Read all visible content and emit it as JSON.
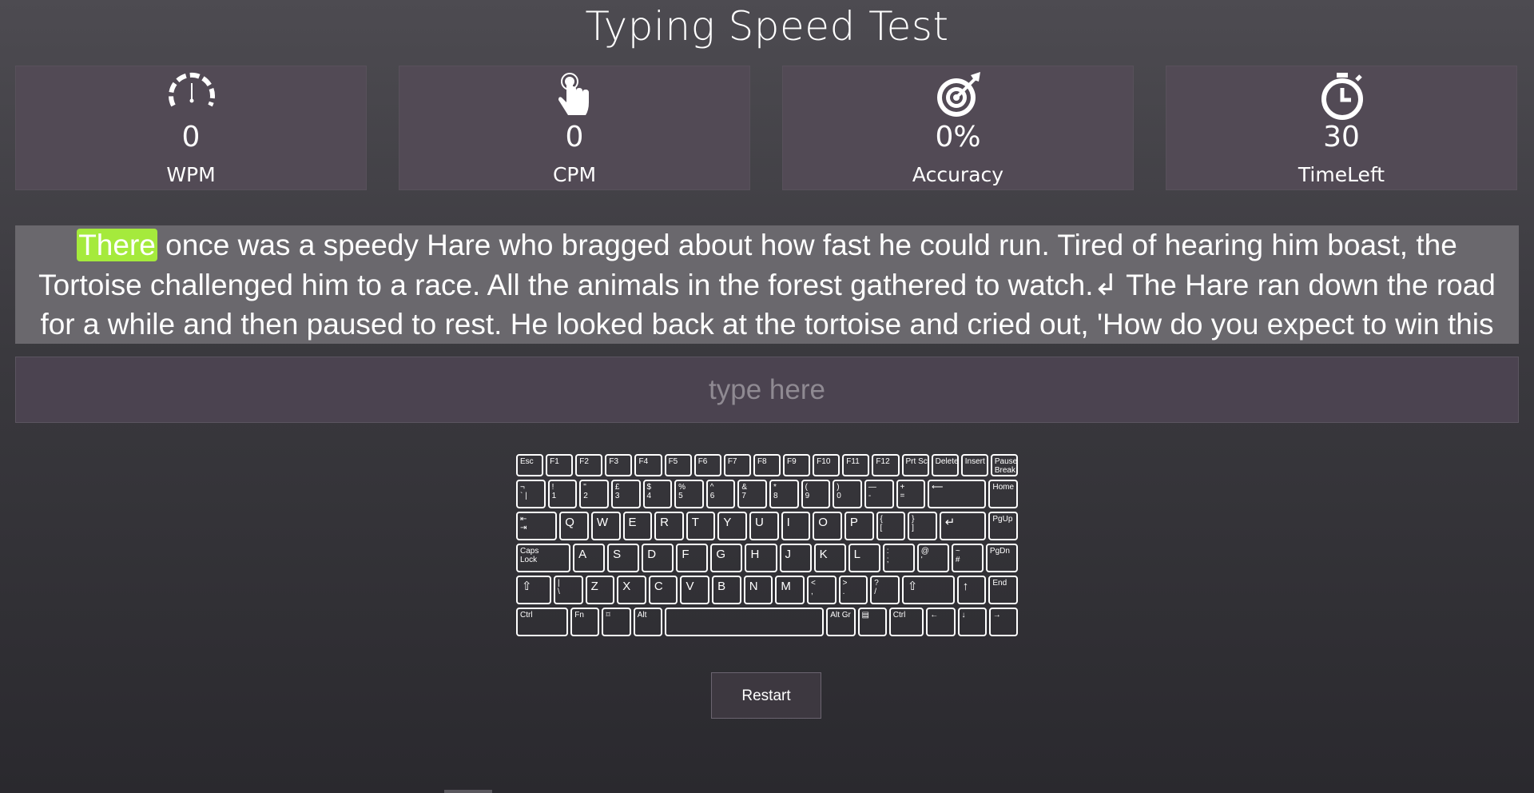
{
  "title": "Typing Speed Test",
  "stats": [
    {
      "icon": "speedometer-icon",
      "value": "0",
      "label": "WPM"
    },
    {
      "icon": "tap-hand-icon",
      "value": "0",
      "label": "CPM"
    },
    {
      "icon": "target-icon",
      "value": "0%",
      "label": "Accuracy"
    },
    {
      "icon": "stopwatch-icon",
      "value": "30",
      "label": "TimeLeft"
    }
  ],
  "passage": {
    "current_word": "There",
    "line1_rest": " once was a speedy Hare who bragged about how fast he could run. Tired of hearing him boast, the",
    "line2": "Tortoise challenged him to a race. All the animals in the forest gathered to watch.↲ The Hare ran down the road",
    "line3": "for a while and then paused to rest. He looked back at the tortoise and cried out, 'How do you expect to win this"
  },
  "input": {
    "placeholder": "type here",
    "value": ""
  },
  "restart_label": "Restart",
  "colors": {
    "highlight": "#a5ea3c",
    "panel": "#524a55",
    "passage_bg": "#6a686d"
  },
  "keyboard": {
    "row0": [
      "Esc",
      "F1",
      "F2",
      "F3",
      "F4",
      "F5",
      "F6",
      "F7",
      "F8",
      "F9",
      "F10",
      "F11",
      "F12",
      "Prt Sc",
      "Delete",
      "Insert",
      "Pause\nBreak"
    ],
    "row1": [
      "¬\n` |",
      "!\n1",
      "\"\n2",
      "£\n3",
      "$\n4",
      "%\n5",
      "^\n6",
      "&\n7",
      "*\n8",
      "(\n9",
      ")\n0",
      "—\n-",
      "+\n=",
      "⟵",
      "Home"
    ],
    "row2": [
      "⇤\n⇥",
      "Q",
      "W",
      "E",
      "R",
      "T",
      "Y",
      "U",
      "I",
      "O",
      "P",
      "{\n[",
      "}\n]",
      "↵",
      "PgUp"
    ],
    "row3": [
      "Caps\nLock",
      "A",
      "S",
      "D",
      "F",
      "G",
      "H",
      "J",
      "K",
      "L",
      ":\n;",
      "@\n'",
      "~\n#",
      "PgDn"
    ],
    "row4": [
      "⇧",
      "|\n\\",
      "Z",
      "X",
      "C",
      "V",
      "B",
      "N",
      "M",
      "<\n,",
      ">\n.",
      "?\n/",
      "⇧",
      "↑",
      "End"
    ],
    "row5": [
      "Ctrl",
      "Fn",
      "⌑",
      "Alt",
      "",
      "Alt Gr",
      "▤",
      "Ctrl",
      "←",
      "↓",
      "→"
    ]
  }
}
